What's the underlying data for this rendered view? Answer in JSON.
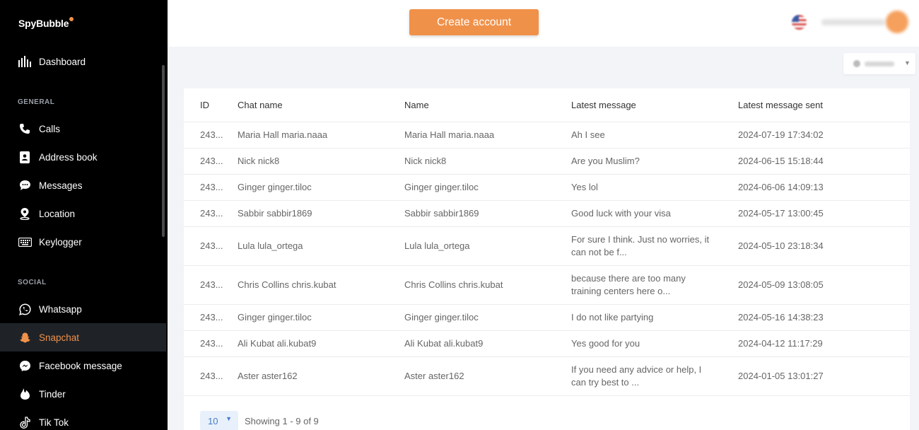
{
  "brand": "SpyBubble",
  "sidebar": {
    "dashboard": "Dashboard",
    "general_label": "GENERAL",
    "general_items": [
      {
        "label": "Calls",
        "icon": "phone-icon"
      },
      {
        "label": "Address book",
        "icon": "contact-book-icon"
      },
      {
        "label": "Messages",
        "icon": "chat-bubble-icon"
      },
      {
        "label": "Location",
        "icon": "location-pin-icon"
      },
      {
        "label": "Keylogger",
        "icon": "keyboard-icon"
      }
    ],
    "social_label": "SOCIAL",
    "social_items": [
      {
        "label": "Whatsapp",
        "icon": "whatsapp-icon"
      },
      {
        "label": "Snapchat",
        "icon": "snapchat-icon",
        "active": true
      },
      {
        "label": "Facebook message",
        "icon": "messenger-icon"
      },
      {
        "label": "Tinder",
        "icon": "tinder-flame-icon"
      },
      {
        "label": "Tik Tok",
        "icon": "tiktok-icon"
      }
    ]
  },
  "topbar": {
    "create_button": "Create account"
  },
  "table": {
    "headers": [
      "ID",
      "Chat name",
      "Name",
      "Latest message",
      "Latest message sent"
    ],
    "rows": [
      {
        "id": "243...",
        "chat_name": "Maria Hall maria.naaa",
        "name": "Maria Hall maria.naaa",
        "message": "Ah I see",
        "sent": "2024-07-19 17:34:02"
      },
      {
        "id": "243...",
        "chat_name": "Nick nick8",
        "name": "Nick nick8",
        "message": "Are you Muslim?",
        "sent": "2024-06-15 15:18:44"
      },
      {
        "id": "243...",
        "chat_name": "Ginger ginger.tiloc",
        "name": "Ginger ginger.tiloc",
        "message": "Yes lol",
        "sent": "2024-06-06 14:09:13"
      },
      {
        "id": "243...",
        "chat_name": "Sabbir sabbir1869",
        "name": "Sabbir sabbir1869",
        "message": "Good luck with your visa",
        "sent": "2024-05-17 13:00:45"
      },
      {
        "id": "243...",
        "chat_name": "Lula lula_ortega",
        "name": "Lula lula_ortega",
        "message": "For sure I think. Just no worries, it can not be f...",
        "sent": "2024-05-10 23:18:34"
      },
      {
        "id": "243...",
        "chat_name": "Chris Collins chris.kubat",
        "name": "Chris Collins chris.kubat",
        "message": "because there are too many training centers here o...",
        "sent": "2024-05-09 13:08:05"
      },
      {
        "id": "243...",
        "chat_name": "Ginger ginger.tiloc",
        "name": "Ginger ginger.tiloc",
        "message": "I do not like partying",
        "sent": "2024-05-16 14:38:23"
      },
      {
        "id": "243...",
        "chat_name": "Ali Kubat ali.kubat9",
        "name": "Ali Kubat ali.kubat9",
        "message": "Yes good for you",
        "sent": "2024-04-12 11:17:29"
      },
      {
        "id": "243...",
        "chat_name": "Aster aster162",
        "name": "Aster aster162",
        "message": "If you need any advice or help, I can try best to ...",
        "sent": "2024-01-05 13:01:27"
      }
    ]
  },
  "pager": {
    "page_size": "10",
    "showing": "Showing 1 - 9 of 9"
  }
}
